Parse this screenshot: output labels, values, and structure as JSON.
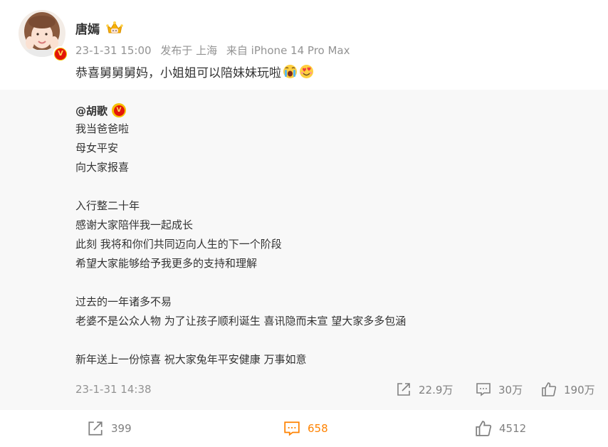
{
  "post": {
    "username": "唐嫣",
    "time": "23-1-31 15:00",
    "location": "发布于 上海",
    "source": "来自 iPhone 14 Pro Max",
    "text": "恭喜舅舅舅妈，小姐姐可以陪妹妹玩啦",
    "emojis": [
      "crying-emoji",
      "heart-eyes-emoji"
    ]
  },
  "repost": {
    "author": "@胡歌",
    "lines": [
      "我当爸爸啦",
      "母女平安",
      "向大家报喜",
      "入行整二十年",
      "感谢大家陪伴我一起成长",
      "此刻 我将和你们共同迈向人生的下一个阶段",
      "希望大家能够给予我更多的支持和理解",
      "过去的一年诸多不易",
      "老婆不是公众人物 为了让孩子顺利诞生 喜讯隐而未宣 望大家多多包涵",
      "新年送上一份惊喜 祝大家兔年平安健康 万事如意"
    ],
    "time": "23-1-31 14:38",
    "stats": {
      "reposts": "22.9万",
      "comments": "30万",
      "likes": "190万"
    }
  },
  "actions": {
    "repost": "399",
    "comment": "658",
    "like": "4512"
  },
  "colors": {
    "accent": "#ff8200",
    "muted": "#939393",
    "repost_bg": "#f8f8f8",
    "verified": "#e3150a"
  }
}
